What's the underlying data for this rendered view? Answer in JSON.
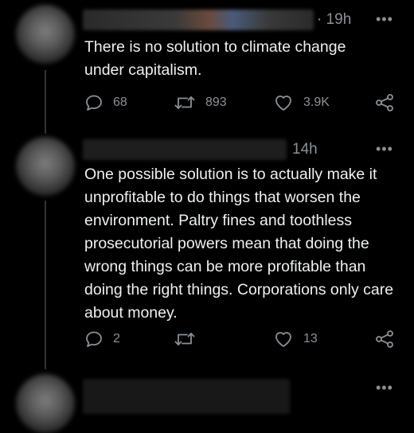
{
  "tweets": [
    {
      "time": "· 19h",
      "more": "•••",
      "text": "There is no solution to climate change under capitalism.",
      "replies": "68",
      "retweets": "893",
      "likes": "3.9K"
    },
    {
      "time": "14h",
      "more": "•••",
      "text": "One possible solution is to actually make it unprofitable to do things that worsen the environment. Paltry fines and toothless prosecutorial powers mean that doing the wrong things can be more profitable than doing the right things. Corporations only care about money.",
      "replies": "2",
      "retweets": "",
      "likes": "13"
    },
    {
      "more": "•••"
    }
  ],
  "colors": {
    "background": "#000000",
    "text": "#e7e9ea",
    "muted": "#8b9197",
    "thread_line": "#2f3336"
  },
  "icons": [
    "reply-icon",
    "retweet-icon",
    "like-icon",
    "share-icon",
    "more-icon"
  ]
}
